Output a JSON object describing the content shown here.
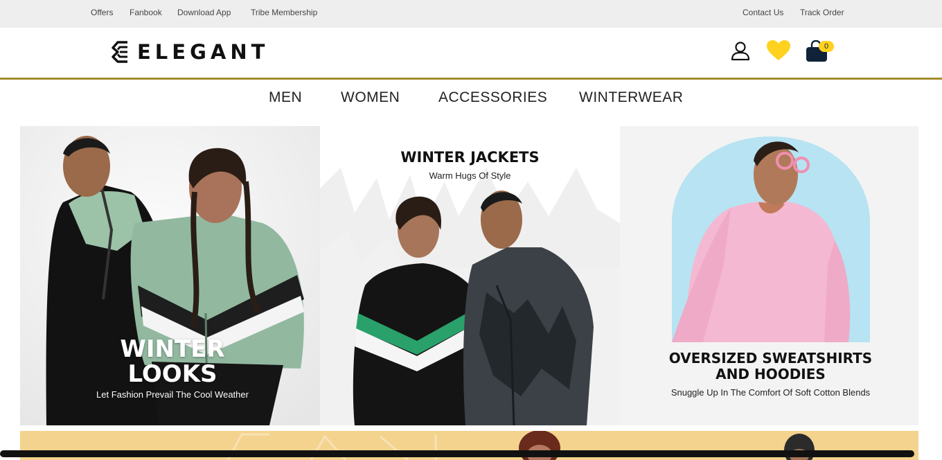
{
  "topbar": {
    "left_links": [
      "Offers",
      "Fanbook",
      "Download App",
      "Tribe Membership"
    ],
    "right_links": [
      "Contact Us",
      "Track Order"
    ]
  },
  "header": {
    "logo_text": "ELEGANT",
    "icons": [
      "user-icon",
      "heart-icon",
      "shopping-bag-icon"
    ],
    "cart_count": "0"
  },
  "nav": {
    "items": [
      "MEN",
      "WOMEN",
      "ACCESSORIES",
      "WINTERWEAR"
    ]
  },
  "tiles": [
    {
      "title_line1": "WINTER",
      "title_line2": "LOOKS",
      "subtitle": "Let Fashion Prevail The Cool Weather"
    },
    {
      "title": "WINTER JACKETS",
      "subtitle": "Warm Hugs Of Style"
    },
    {
      "title_line1": "OVERSIZED SWEATSHIRTS",
      "title_line2": "AND HOODIES",
      "subtitle": "Snuggle Up In The Comfort Of Soft Cotton Blends"
    }
  ],
  "colors": {
    "accent_gold": "#a48d2c",
    "heart_yellow": "#ffd21f",
    "topbar_bg": "#eeeeee",
    "promo_bg": "#f3d38e"
  }
}
